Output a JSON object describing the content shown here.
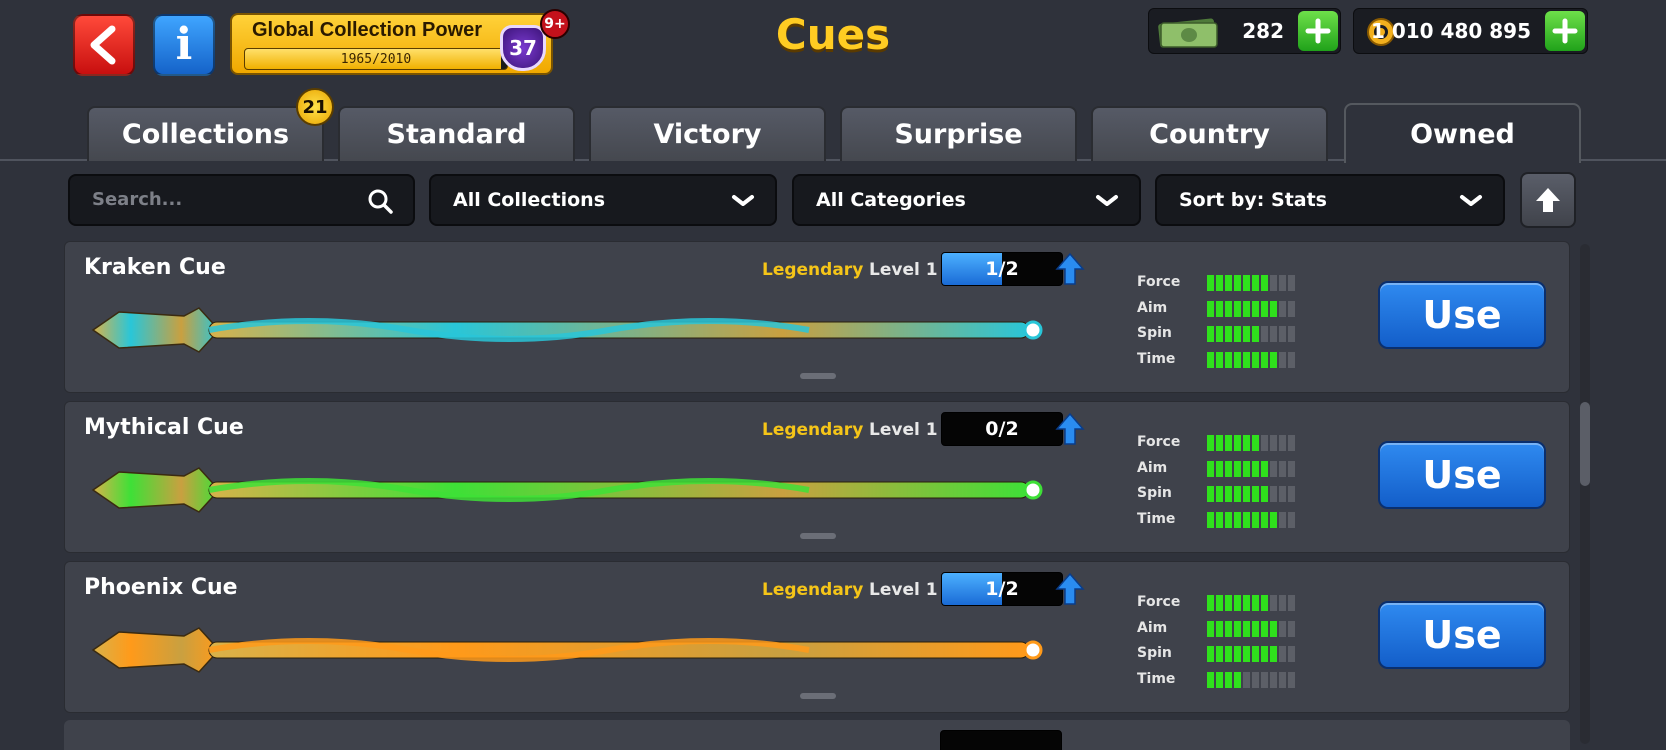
{
  "header": {
    "title": "Cues",
    "back_icon": "chevron-left-icon",
    "info_label": "i",
    "collection_power": {
      "title": "Global Collection Power",
      "progress_text": "1965/2010",
      "progress_fraction": 0.9776,
      "level": "37",
      "badge": "9+"
    },
    "cash": {
      "value": "282",
      "icon": "cash-icon"
    },
    "coins": {
      "value": "1 010 480 895",
      "icon": "coin-icon"
    },
    "colors": {
      "title": "#ffcc22",
      "plus": "#2ecc40"
    }
  },
  "tabs": [
    {
      "label": "Collections",
      "badge": "21",
      "active": false
    },
    {
      "label": "Standard",
      "active": false
    },
    {
      "label": "Victory",
      "active": false
    },
    {
      "label": "Surprise",
      "active": false
    },
    {
      "label": "Country",
      "active": false
    },
    {
      "label": "Owned",
      "active": true
    }
  ],
  "filters": {
    "search_placeholder": "Search...",
    "collections": "All Collections",
    "categories": "All Categories",
    "sort": "Sort by: Stats"
  },
  "cues": [
    {
      "name": "Kraken Cue",
      "rarity": "Legendary",
      "level": "Level 1",
      "progress_text": "1/2",
      "progress_fraction": 0.5,
      "stats": {
        "force": 7,
        "aim": 8,
        "spin": 6,
        "time": 8
      },
      "stat_labels": [
        "Force",
        "Aim",
        "Spin",
        "Time"
      ],
      "use_label": "Use",
      "theme": "#29c6d8"
    },
    {
      "name": "Mythical Cue",
      "rarity": "Legendary",
      "level": "Level 1",
      "progress_text": "0/2",
      "progress_fraction": 0,
      "stats": {
        "force": 6,
        "aim": 7,
        "spin": 7,
        "time": 8
      },
      "stat_labels": [
        "Force",
        "Aim",
        "Spin",
        "Time"
      ],
      "use_label": "Use",
      "theme": "#3ee037"
    },
    {
      "name": "Phoenix Cue",
      "rarity": "Legendary",
      "level": "Level 1",
      "progress_text": "1/2",
      "progress_fraction": 0.5,
      "stats": {
        "force": 7,
        "aim": 8,
        "spin": 8,
        "time": 4
      },
      "stat_labels": [
        "Force",
        "Aim",
        "Spin",
        "Time"
      ],
      "use_label": "Use",
      "theme": "#ff9a1a"
    }
  ],
  "stat_max": 10
}
